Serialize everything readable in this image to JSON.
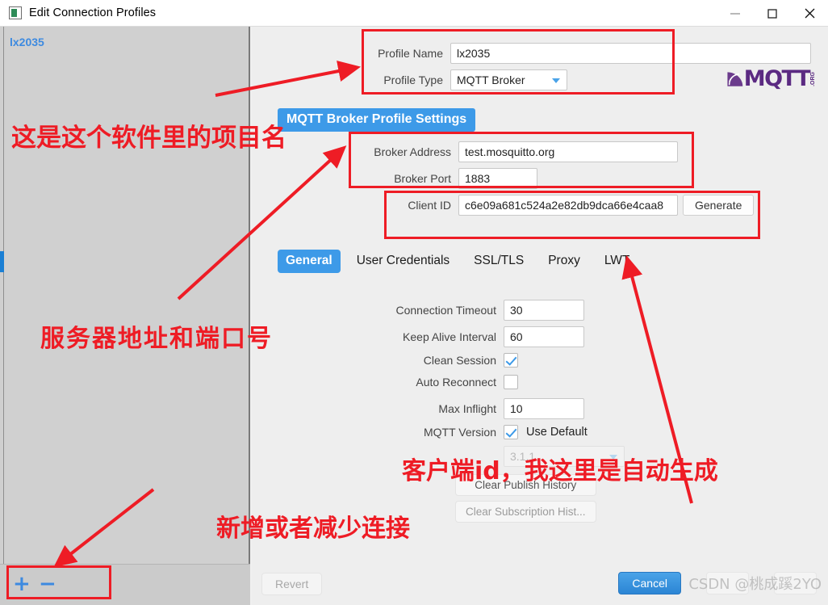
{
  "window": {
    "title": "Edit Connection Profiles",
    "icon": "app-icon",
    "controls": {
      "minimize": "—",
      "maximize": "☐",
      "close": "✕"
    }
  },
  "sidebar": {
    "items": [
      {
        "label": "lx2035",
        "selected": true
      }
    ],
    "footer": {
      "add_label": "+",
      "remove_label": "−"
    }
  },
  "profile": {
    "name_label": "Profile Name",
    "name_value": "lx2035",
    "type_label": "Profile Type",
    "type_value": "MQTT Broker",
    "logo_text": "MQTT",
    "logo_org": ".ORG"
  },
  "section": {
    "heading": "MQTT Broker Profile Settings"
  },
  "broker": {
    "address_label": "Broker Address",
    "address_value": "test.mosquitto.org",
    "port_label": "Broker Port",
    "port_value": "1883",
    "client_id_label": "Client ID",
    "client_id_value": "c6e09a681c524a2e82db9dca66e4caa8",
    "generate_label": "Generate"
  },
  "tabs": [
    {
      "label": "General",
      "active": true
    },
    {
      "label": "User Credentials",
      "active": false
    },
    {
      "label": "SSL/TLS",
      "active": false
    },
    {
      "label": "Proxy",
      "active": false
    },
    {
      "label": "LWT",
      "active": false
    }
  ],
  "general": {
    "connection_timeout_label": "Connection Timeout",
    "connection_timeout_value": "30",
    "keep_alive_label": "Keep Alive Interval",
    "keep_alive_value": "60",
    "clean_session_label": "Clean Session",
    "clean_session_checked": true,
    "auto_reconnect_label": "Auto Reconnect",
    "auto_reconnect_checked": false,
    "max_inflight_label": "Max Inflight",
    "max_inflight_value": "10",
    "mqtt_version_label": "MQTT Version",
    "use_default_label": "Use Default",
    "use_default_checked": true,
    "version_value": "3.1.1"
  },
  "history": {
    "clear_publish_label": "Clear Publish History",
    "clear_subscription_label": "Clear Subscription Hist..."
  },
  "footer": {
    "revert_label": "Revert",
    "cancel_label": "Cancel"
  },
  "annotations": [
    {
      "id": "project-name",
      "text": "这是这个软件里的项目名"
    },
    {
      "id": "server-address-port",
      "text": "服务器地址和端口号"
    },
    {
      "id": "client-id",
      "text": "客户端id，我这里是自动生成"
    },
    {
      "id": "add-remove-connection",
      "text": "新增或者减少连接"
    }
  ],
  "watermark": {
    "text": "CSDN @桃成蹊2YO"
  },
  "colors": {
    "accent": "#3d9ae8",
    "annotation": "#ee1c25",
    "sidebar_item": "#3d8ae0",
    "logo": "#5b2a82"
  }
}
